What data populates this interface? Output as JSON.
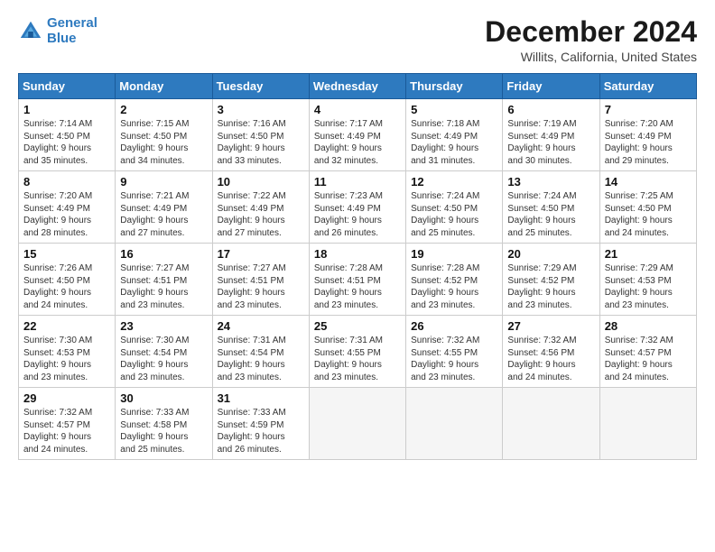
{
  "logo": {
    "line1": "General",
    "line2": "Blue"
  },
  "title": "December 2024",
  "subtitle": "Willits, California, United States",
  "weekdays": [
    "Sunday",
    "Monday",
    "Tuesday",
    "Wednesday",
    "Thursday",
    "Friday",
    "Saturday"
  ],
  "weeks": [
    [
      {
        "day": "1",
        "info": "Sunrise: 7:14 AM\nSunset: 4:50 PM\nDaylight: 9 hours\nand 35 minutes."
      },
      {
        "day": "2",
        "info": "Sunrise: 7:15 AM\nSunset: 4:50 PM\nDaylight: 9 hours\nand 34 minutes."
      },
      {
        "day": "3",
        "info": "Sunrise: 7:16 AM\nSunset: 4:50 PM\nDaylight: 9 hours\nand 33 minutes."
      },
      {
        "day": "4",
        "info": "Sunrise: 7:17 AM\nSunset: 4:49 PM\nDaylight: 9 hours\nand 32 minutes."
      },
      {
        "day": "5",
        "info": "Sunrise: 7:18 AM\nSunset: 4:49 PM\nDaylight: 9 hours\nand 31 minutes."
      },
      {
        "day": "6",
        "info": "Sunrise: 7:19 AM\nSunset: 4:49 PM\nDaylight: 9 hours\nand 30 minutes."
      },
      {
        "day": "7",
        "info": "Sunrise: 7:20 AM\nSunset: 4:49 PM\nDaylight: 9 hours\nand 29 minutes."
      }
    ],
    [
      {
        "day": "8",
        "info": "Sunrise: 7:20 AM\nSunset: 4:49 PM\nDaylight: 9 hours\nand 28 minutes."
      },
      {
        "day": "9",
        "info": "Sunrise: 7:21 AM\nSunset: 4:49 PM\nDaylight: 9 hours\nand 27 minutes."
      },
      {
        "day": "10",
        "info": "Sunrise: 7:22 AM\nSunset: 4:49 PM\nDaylight: 9 hours\nand 27 minutes."
      },
      {
        "day": "11",
        "info": "Sunrise: 7:23 AM\nSunset: 4:49 PM\nDaylight: 9 hours\nand 26 minutes."
      },
      {
        "day": "12",
        "info": "Sunrise: 7:24 AM\nSunset: 4:50 PM\nDaylight: 9 hours\nand 25 minutes."
      },
      {
        "day": "13",
        "info": "Sunrise: 7:24 AM\nSunset: 4:50 PM\nDaylight: 9 hours\nand 25 minutes."
      },
      {
        "day": "14",
        "info": "Sunrise: 7:25 AM\nSunset: 4:50 PM\nDaylight: 9 hours\nand 24 minutes."
      }
    ],
    [
      {
        "day": "15",
        "info": "Sunrise: 7:26 AM\nSunset: 4:50 PM\nDaylight: 9 hours\nand 24 minutes."
      },
      {
        "day": "16",
        "info": "Sunrise: 7:27 AM\nSunset: 4:51 PM\nDaylight: 9 hours\nand 23 minutes."
      },
      {
        "day": "17",
        "info": "Sunrise: 7:27 AM\nSunset: 4:51 PM\nDaylight: 9 hours\nand 23 minutes."
      },
      {
        "day": "18",
        "info": "Sunrise: 7:28 AM\nSunset: 4:51 PM\nDaylight: 9 hours\nand 23 minutes."
      },
      {
        "day": "19",
        "info": "Sunrise: 7:28 AM\nSunset: 4:52 PM\nDaylight: 9 hours\nand 23 minutes."
      },
      {
        "day": "20",
        "info": "Sunrise: 7:29 AM\nSunset: 4:52 PM\nDaylight: 9 hours\nand 23 minutes."
      },
      {
        "day": "21",
        "info": "Sunrise: 7:29 AM\nSunset: 4:53 PM\nDaylight: 9 hours\nand 23 minutes."
      }
    ],
    [
      {
        "day": "22",
        "info": "Sunrise: 7:30 AM\nSunset: 4:53 PM\nDaylight: 9 hours\nand 23 minutes."
      },
      {
        "day": "23",
        "info": "Sunrise: 7:30 AM\nSunset: 4:54 PM\nDaylight: 9 hours\nand 23 minutes."
      },
      {
        "day": "24",
        "info": "Sunrise: 7:31 AM\nSunset: 4:54 PM\nDaylight: 9 hours\nand 23 minutes."
      },
      {
        "day": "25",
        "info": "Sunrise: 7:31 AM\nSunset: 4:55 PM\nDaylight: 9 hours\nand 23 minutes."
      },
      {
        "day": "26",
        "info": "Sunrise: 7:32 AM\nSunset: 4:55 PM\nDaylight: 9 hours\nand 23 minutes."
      },
      {
        "day": "27",
        "info": "Sunrise: 7:32 AM\nSunset: 4:56 PM\nDaylight: 9 hours\nand 24 minutes."
      },
      {
        "day": "28",
        "info": "Sunrise: 7:32 AM\nSunset: 4:57 PM\nDaylight: 9 hours\nand 24 minutes."
      }
    ],
    [
      {
        "day": "29",
        "info": "Sunrise: 7:32 AM\nSunset: 4:57 PM\nDaylight: 9 hours\nand 24 minutes."
      },
      {
        "day": "30",
        "info": "Sunrise: 7:33 AM\nSunset: 4:58 PM\nDaylight: 9 hours\nand 25 minutes."
      },
      {
        "day": "31",
        "info": "Sunrise: 7:33 AM\nSunset: 4:59 PM\nDaylight: 9 hours\nand 26 minutes."
      },
      null,
      null,
      null,
      null
    ]
  ]
}
